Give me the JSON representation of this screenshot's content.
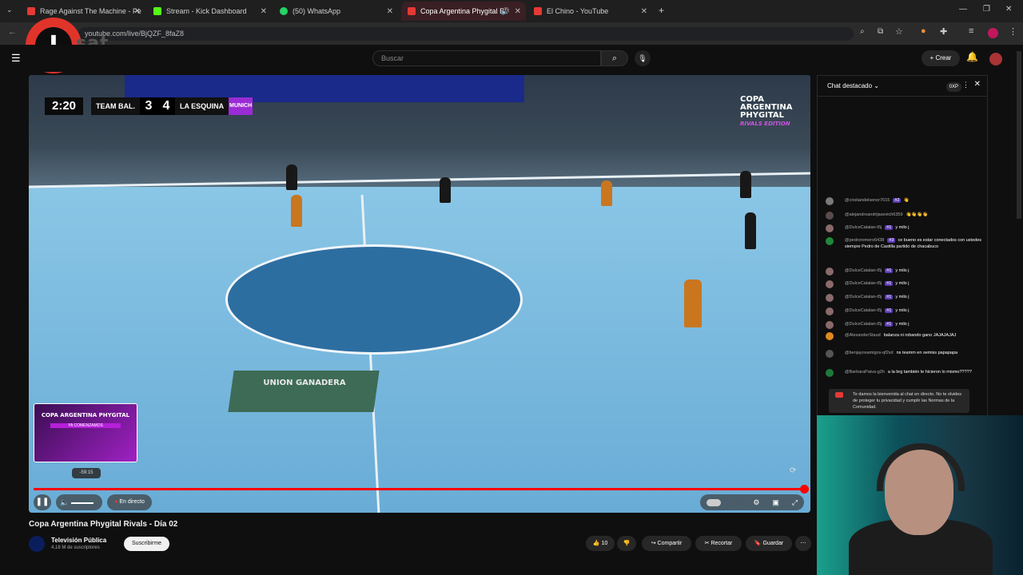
{
  "browser": {
    "tabs": [
      {
        "title": "Rage Against The Machine - Pe",
        "color": "#e53935"
      },
      {
        "title": "Stream - Kick Dashboard",
        "color": "#53fc18"
      },
      {
        "title": "(50) WhatsApp",
        "color": "#25d366"
      },
      {
        "title": "Copa Argentina Phygital Ri",
        "color": "#e53935"
      },
      {
        "title": "El Chino - YouTube",
        "color": "#e53935"
      }
    ],
    "url": "youtube.com/live/BjQZF_8faZ8"
  },
  "overlay_logo": {
    "letter": "I",
    "text": "sat"
  },
  "youtube": {
    "search_placeholder": "Buscar",
    "create_label": "Crear"
  },
  "video": {
    "scoreboard": {
      "time": "2:20",
      "team1": "TEAM BAL.",
      "score1": "3",
      "score2": "4",
      "team2": "LA ESQUINA",
      "logo": "MUNICH"
    },
    "cup": {
      "line1": "COPA",
      "line2": "ARGENTINA",
      "line3": "PHYGITAL",
      "line4": "RIVALS EDITION"
    },
    "sponsor": "UNION GANADERA",
    "preview": {
      "title": "COPA ARGENTINA PHYGITAL",
      "sub": "YA COMENZAMOS"
    },
    "seek_time": "-59:15",
    "live_label": "En directo",
    "progress": 1.0
  },
  "info": {
    "title": "Copa Argentina Phygital Rivals - Día 02",
    "channel": "Televisión Pública",
    "subscribers": "4,18 M de suscriptores",
    "subscribe_label": "Suscribirme",
    "likes": "10",
    "share_label": "Compartir",
    "clip_label": "Recortar",
    "save_label": "Guardar"
  },
  "chat": {
    "header": "Chat destacado",
    "xp": "0XP",
    "messages": [
      {
        "author": "@cristiandelsenor7015",
        "badge": "#2",
        "text": "👋"
      },
      {
        "author": "@alejandroandrijasevich6359",
        "badge": "",
        "text": "👋👋👋👋"
      },
      {
        "author": "@DulceCatalan-t5j",
        "badge": "#1",
        "text": "y milo j"
      },
      {
        "author": "@pedroromero6438",
        "badge": "#3",
        "text": "ce bueno es estar conectados con ustedes siempre Pedro de Castilla partido de chacabuco"
      },
      {
        "author": "@DulceCatalan-t5j",
        "badge": "#1",
        "text": "y milo j"
      },
      {
        "author": "@DulceCatalan-t5j",
        "badge": "#1",
        "text": "y milo j"
      },
      {
        "author": "@DulceCatalan-t5j",
        "badge": "#1",
        "text": "y milo j"
      },
      {
        "author": "@DulceCatalan-t5j",
        "badge": "#1",
        "text": "y milo j"
      },
      {
        "author": "@DulceCatalan-t5j",
        "badge": "#1",
        "text": "y milo j"
      },
      {
        "author": "@AlexanderStaud",
        "badge": "",
        "text": "balanza ni robando gano JAJAJAJAJ"
      },
      {
        "author": "@benjayosamigos-qf2xd",
        "badge": "",
        "text": "ns teamm en semiss papapapa"
      },
      {
        "author": "@BarbaraPaiva-g2h",
        "badge": "",
        "text": "a la brg también le hicieron lo mismo?????"
      }
    ],
    "welcome": "Te damos la bienvenida al chat en directo. No te olvides de proteger tu privacidad y cumplir las Normas de la Comunidad."
  }
}
